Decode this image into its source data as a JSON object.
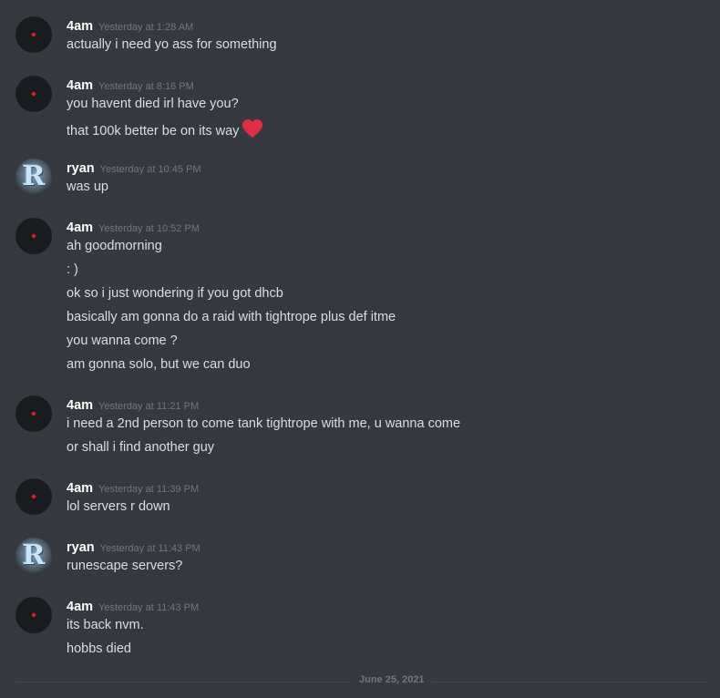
{
  "groups": [
    {
      "author": "4am",
      "avatar": "red-dot",
      "time": "Yesterday at 1:28 AM",
      "messages": [
        "actually i need yo ass for something"
      ]
    },
    {
      "author": "4am",
      "avatar": "red-dot",
      "time": "Yesterday at 8:16 PM",
      "messages": [
        "you havent died irl have you?",
        "that 100k better be on its way"
      ],
      "emoji": "red-heart"
    },
    {
      "author": "ryan",
      "avatar": "R",
      "time": "Yesterday at 10:45 PM",
      "messages": [
        "was up"
      ]
    },
    {
      "author": "4am",
      "avatar": "red-dot",
      "time": "Yesterday at 10:52 PM",
      "messages": [
        "ah goodmorning",
        ": )",
        "ok so i just wondering if you got dhcb",
        "basically am gonna do a raid with tightrope plus def itme",
        "you wanna come ?",
        "am gonna solo, but we can duo"
      ]
    },
    {
      "author": "4am",
      "avatar": "red-dot",
      "time": "Yesterday at 11:21 PM",
      "messages": [
        "i need a 2nd person to come tank tightrope with me, u wanna come",
        "or shall i find another guy"
      ]
    },
    {
      "author": "4am",
      "avatar": "red-dot",
      "time": "Yesterday at 11:39 PM",
      "messages": [
        "lol servers r down"
      ]
    },
    {
      "author": "ryan",
      "avatar": "R",
      "time": "Yesterday at 11:43 PM",
      "messages": [
        "runescape servers?"
      ]
    },
    {
      "author": "4am",
      "avatar": "red-dot",
      "time": "Yesterday at 11:43 PM",
      "messages": [
        "its back nvm.",
        "hobbs died"
      ]
    }
  ],
  "date_divider": "June 25, 2021",
  "colors": {
    "background": "#36393f",
    "username": "#ffffff",
    "timestamp": "#72767d",
    "text": "#dcddde",
    "heart": "#dd2e44"
  }
}
